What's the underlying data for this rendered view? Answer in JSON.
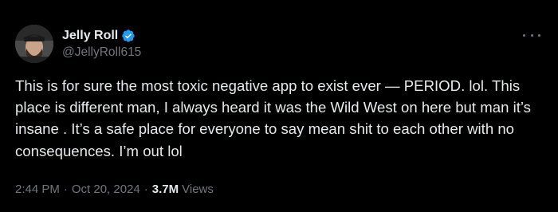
{
  "author": {
    "display_name": "Jelly Roll",
    "handle": "@JellyRoll615",
    "verified_icon": "verified-badge-icon",
    "verified_color": "#1d9bf0"
  },
  "tweet": {
    "text": "This is for sure the most toxic negative app to exist ever — PERIOD. lol. This place is different man, I always heard it was the Wild West on here but man it’s insane . It’s a safe place for everyone to say mean shit to each other with no consequences. I’m out lol"
  },
  "meta": {
    "time": "2:44 PM",
    "separator": "·",
    "date": "Oct 20, 2024",
    "views_count": "3.7M",
    "views_label": "Views"
  },
  "icons": {
    "more": "more-options-icon"
  },
  "colors": {
    "background": "#000000",
    "text_primary": "#e7e9ea",
    "text_secondary": "#71767b"
  }
}
